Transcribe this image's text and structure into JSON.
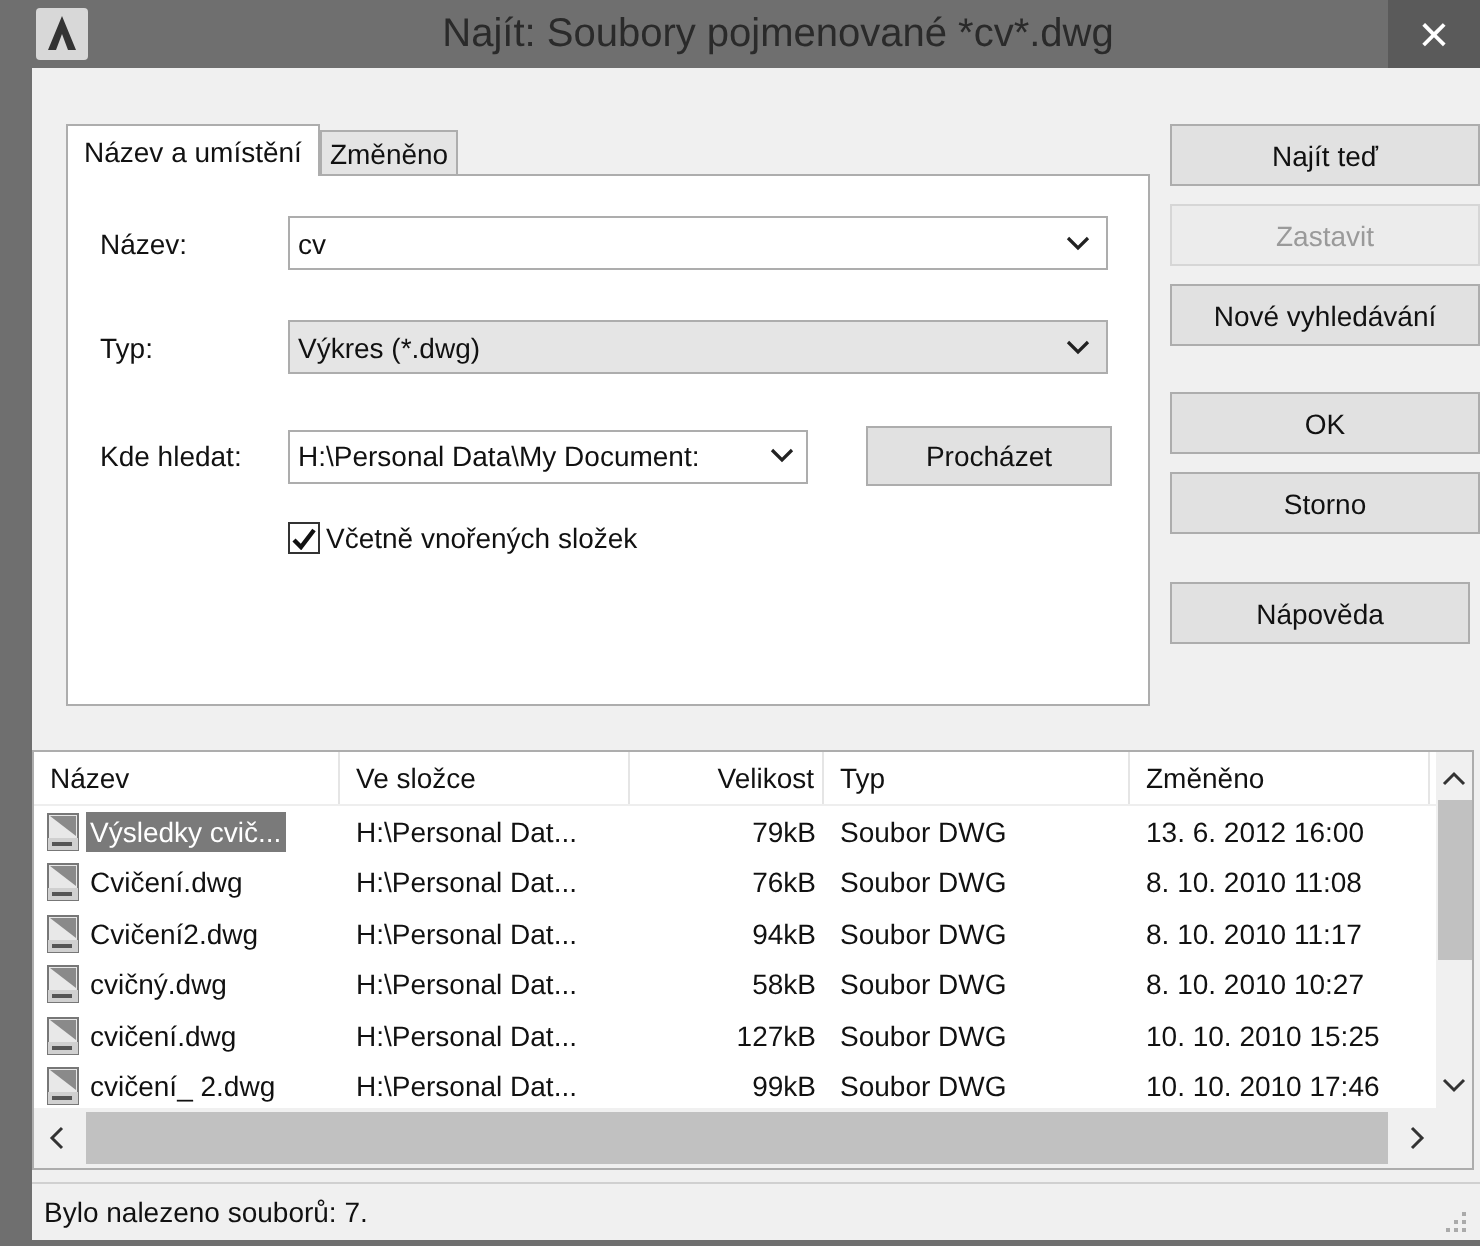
{
  "window": {
    "title": "Najít: Soubory pojmenované *cv*.dwg",
    "close": "×"
  },
  "tabs": [
    {
      "label": "Název a umístění",
      "selected": true
    },
    {
      "label": "Změněno",
      "selected": false
    }
  ],
  "fields": [
    {
      "kind": "combo",
      "label": "Název:",
      "value": "cv"
    },
    {
      "kind": "dropdown",
      "label": "Typ:",
      "value": "Výkres (*.dwg)"
    }
  ],
  "look_in": {
    "label": "Kde hledat:",
    "value": "H:\\Personal Data\\My Document:",
    "browse": {
      "label": "Procházet"
    }
  },
  "subfolders": {
    "label": "Včetně vnořených složek",
    "checked": true
  },
  "buttons": [
    {
      "label": "Najít teď",
      "disabled": false
    },
    {
      "label": "Zastavit",
      "disabled": true
    },
    {
      "label": "Nové vyhledávání",
      "disabled": false
    },
    {
      "label": "OK",
      "disabled": false
    },
    {
      "label": "Storno",
      "disabled": false
    },
    {
      "label": "Nápověda",
      "disabled": false
    }
  ],
  "table": {
    "columns": [
      "Název",
      "Ve složce",
      "Velikost",
      "Typ",
      "Změněno"
    ],
    "rows": [
      {
        "name": "Výsledky cvič...",
        "folder": "H:\\Personal Dat...",
        "size": "79kB",
        "type": "Soubor DWG",
        "modified": "13. 6. 2012 16:00",
        "selected": true
      },
      {
        "name": "Cvičení.dwg",
        "folder": "H:\\Personal Dat...",
        "size": "76kB",
        "type": "Soubor DWG",
        "modified": "8. 10. 2010 11:08",
        "selected": false
      },
      {
        "name": "Cvičení2.dwg",
        "folder": "H:\\Personal Dat...",
        "size": "94kB",
        "type": "Soubor DWG",
        "modified": "8. 10. 2010 11:17",
        "selected": false
      },
      {
        "name": "cvičný.dwg",
        "folder": "H:\\Personal Dat...",
        "size": "58kB",
        "type": "Soubor DWG",
        "modified": "8. 10. 2010 10:27",
        "selected": false
      },
      {
        "name": "cvičení.dwg",
        "folder": "H:\\Personal Dat...",
        "size": "127kB",
        "type": "Soubor DWG",
        "modified": "10. 10. 2010 15:25",
        "selected": false
      },
      {
        "name": "cvičení_ 2.dwg",
        "folder": "H:\\Personal Dat...",
        "size": "99kB",
        "type": "Soubor DWG",
        "modified": "10. 10. 2010 17:46",
        "selected": false
      }
    ]
  },
  "status_bar": "Bylo nalezeno souborů: 7."
}
